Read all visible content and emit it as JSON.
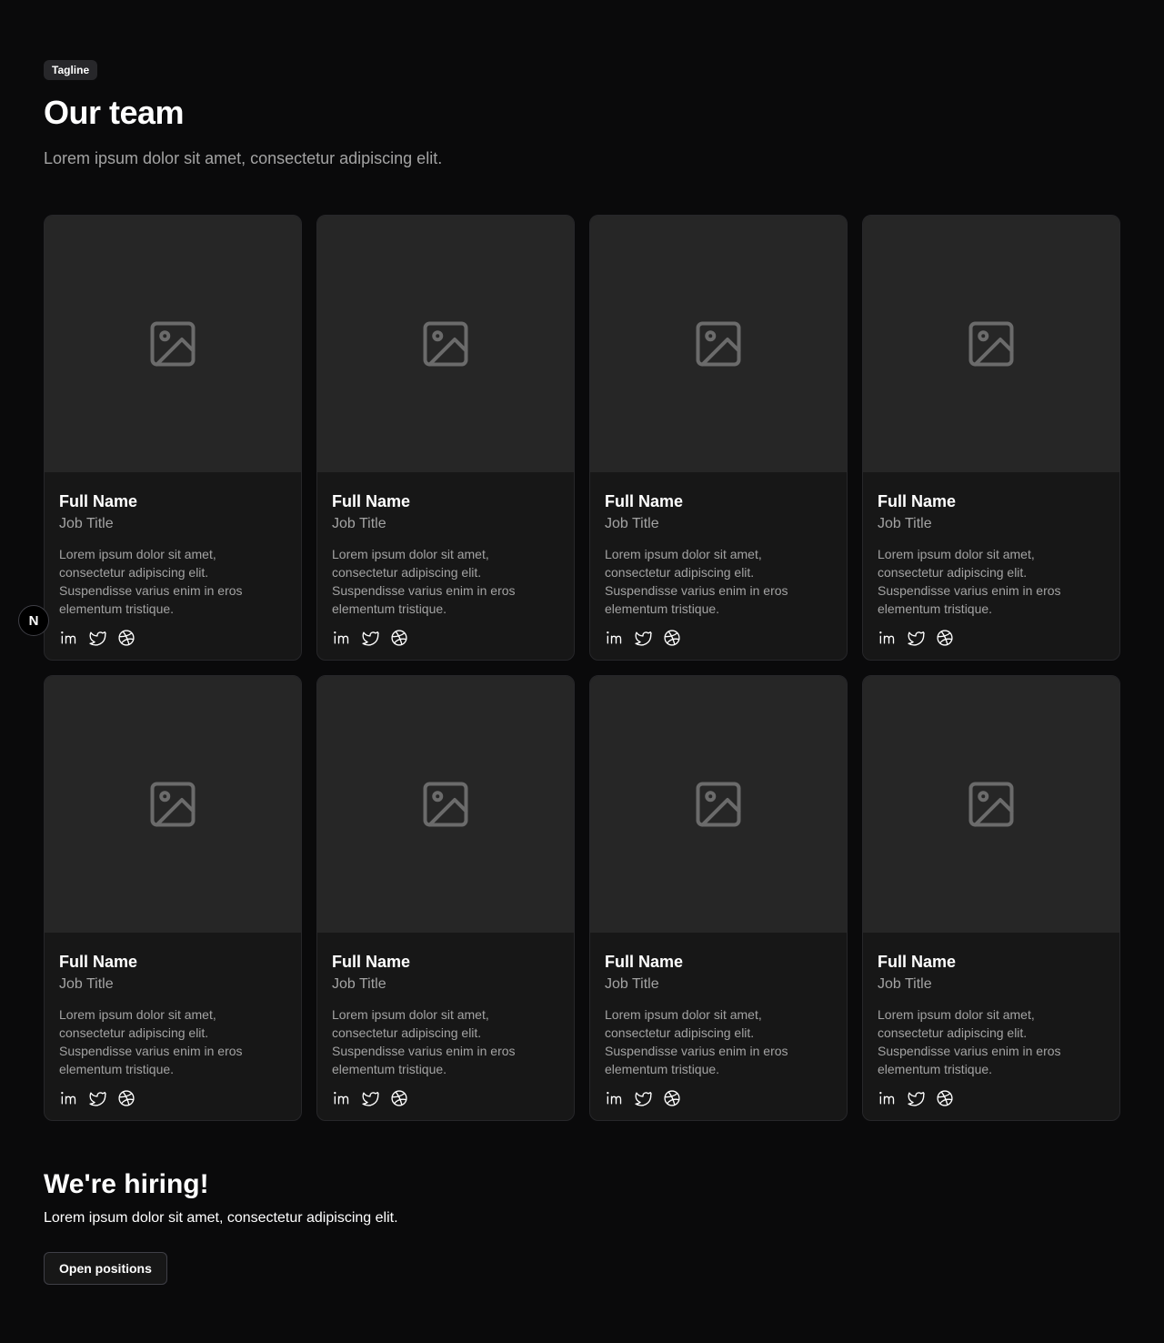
{
  "header": {
    "tagline": "Tagline",
    "title": "Our team",
    "subtitle": "Lorem ipsum dolor sit amet, consectetur adipiscing elit."
  },
  "team": [
    {
      "name": "Full Name",
      "role": "Job Title",
      "bio": "Lorem ipsum dolor sit amet, consectetur adipiscing elit. Suspendisse varius enim in eros elementum tristique."
    },
    {
      "name": "Full Name",
      "role": "Job Title",
      "bio": "Lorem ipsum dolor sit amet, consectetur adipiscing elit. Suspendisse varius enim in eros elementum tristique."
    },
    {
      "name": "Full Name",
      "role": "Job Title",
      "bio": "Lorem ipsum dolor sit amet, consectetur adipiscing elit. Suspendisse varius enim in eros elementum tristique."
    },
    {
      "name": "Full Name",
      "role": "Job Title",
      "bio": "Lorem ipsum dolor sit amet, consectetur adipiscing elit. Suspendisse varius enim in eros elementum tristique."
    },
    {
      "name": "Full Name",
      "role": "Job Title",
      "bio": "Lorem ipsum dolor sit amet, consectetur adipiscing elit. Suspendisse varius enim in eros elementum tristique."
    },
    {
      "name": "Full Name",
      "role": "Job Title",
      "bio": "Lorem ipsum dolor sit amet, consectetur adipiscing elit. Suspendisse varius enim in eros elementum tristique."
    },
    {
      "name": "Full Name",
      "role": "Job Title",
      "bio": "Lorem ipsum dolor sit amet, consectetur adipiscing elit. Suspendisse varius enim in eros elementum tristique."
    },
    {
      "name": "Full Name",
      "role": "Job Title",
      "bio": "Lorem ipsum dolor sit amet, consectetur adipiscing elit. Suspendisse varius enim in eros elementum tristique."
    }
  ],
  "social_icons": [
    "linkedin-icon",
    "twitter-icon",
    "dribbble-icon"
  ],
  "image_placeholder_icon": "image-icon",
  "hiring": {
    "title": "We're hiring!",
    "text": "Lorem ipsum dolor sit amet, consectetur adipiscing elit.",
    "button_label": "Open positions"
  },
  "dev_badge": {
    "label": "N"
  },
  "colors": {
    "background": "#0a0a0b",
    "card": "#171717",
    "image_placeholder": "#262626",
    "muted_text": "#a3a3a3"
  }
}
